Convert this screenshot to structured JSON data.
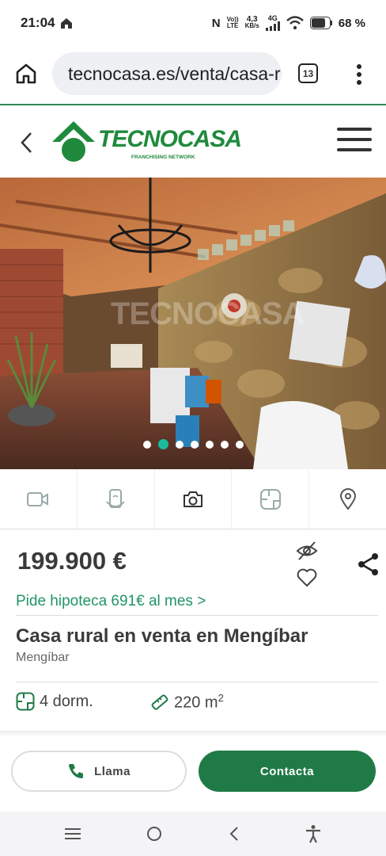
{
  "status_bar": {
    "time": "21:04",
    "nfc": "N",
    "volte_line1": "Vo))",
    "volte_line2": "LTE",
    "speed_value": "4,3",
    "speed_unit": "KB/s",
    "network": "4G",
    "battery": "68 %"
  },
  "browser": {
    "url": "tecnocasa.es/venta/casa-rural",
    "tab_count": "13"
  },
  "header": {
    "brand": "TECNOCASA",
    "tagline": "FRANCHISING NETWORK"
  },
  "gallery": {
    "watermark": "TECNOCASA",
    "dot_count": 7,
    "active_dot": 1,
    "accent_color": "#1abc9c"
  },
  "media_tabs": [
    "video-icon",
    "virtual-tour-icon",
    "photo-icon",
    "floorplan-icon",
    "location-pin-icon"
  ],
  "listing": {
    "price": "199.900 €",
    "mortgage": "Pide hipoteca 691€ al mes >",
    "title": "Casa rural en venta en Mengíbar",
    "location": "Mengíbar",
    "bedrooms": "4 dorm.",
    "area": "220 m",
    "area_sup": "2"
  },
  "actions": {
    "call": "Llama",
    "contact": "Contacta"
  },
  "colors": {
    "brand_green": "#1f7a46",
    "link_green": "#219564"
  }
}
